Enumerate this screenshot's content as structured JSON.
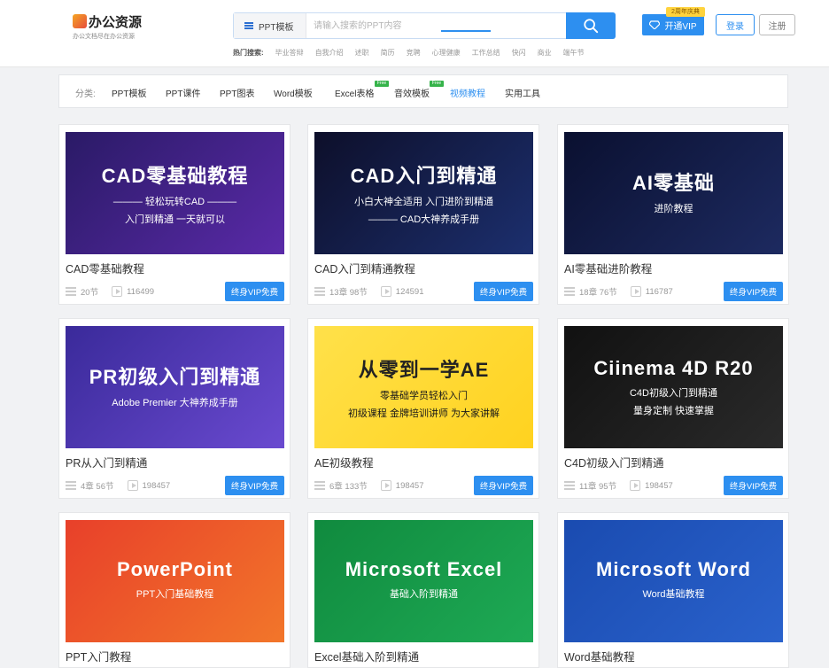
{
  "header": {
    "logo_title": "办公资源",
    "logo_subtitle": "办公文档尽在办公资源",
    "search_category": "PPT模板",
    "search_placeholder": "请输入搜索的PPT内容",
    "hot_label": "热门搜索:",
    "hot_terms": [
      "毕业答辩",
      "自我介绍",
      "述职",
      "简历",
      "竞聘",
      "心理健康",
      "工作总结",
      "快闪",
      "商业",
      "端午节"
    ],
    "vip_label": "开通VIP",
    "vip_badge": "2周年庆典",
    "login_label": "登录",
    "register_label": "注册"
  },
  "categories": {
    "label": "分类:",
    "items": [
      "PPT模板",
      "PPT课件",
      "PPT图表",
      "Word模板",
      "Excel表格",
      "音效模板",
      "视频教程",
      "实用工具"
    ],
    "free_tag": "Free",
    "active": "视频教程"
  },
  "card_button_label": "终身VIP免费",
  "cards": [
    {
      "title": "CAD零基础教程",
      "lessons": "20节",
      "views": "116499",
      "thumb_lines": [
        "CAD零基础教程",
        "——— 轻松玩转CAD ———",
        "入门到精通 一天就可以"
      ],
      "colors": [
        "#2a1a66",
        "#5a2aa8"
      ]
    },
    {
      "title": "CAD入门到精通教程",
      "lessons": "13章 98节",
      "views": "124591",
      "thumb_lines": [
        "CAD入门到精通",
        "小白大神全适用 入门进阶到精通",
        "——— CAD大神养成手册"
      ],
      "colors": [
        "#0d0f2a",
        "#1c2f6e"
      ]
    },
    {
      "title": "AI零基础进阶教程",
      "lessons": "18章 76节",
      "views": "116787",
      "thumb_lines": [
        "AI零基础",
        "进阶教程",
        ""
      ],
      "colors": [
        "#0a1030",
        "#1d2a60"
      ]
    },
    {
      "title": "PR从入门到精通",
      "lessons": "4章 56节",
      "views": "198457",
      "thumb_lines": [
        "PR初级入门到精通",
        "Adobe Premier 大神养成手册",
        ""
      ],
      "colors": [
        "#3a2a9a",
        "#6a4ad0"
      ]
    },
    {
      "title": "AE初级教程",
      "lessons": "6章 133节",
      "views": "198457",
      "thumb_lines": [
        "从零到一学AE",
        "零基础学员轻松入门",
        "初级课程  金牌培训讲师 为大家讲解"
      ],
      "colors": [
        "#ffe14a",
        "#ffd21f"
      ]
    },
    {
      "title": "C4D初级入门到精通",
      "lessons": "11章 95节",
      "views": "198457",
      "thumb_lines": [
        "Ciinema 4D R20",
        "C4D初级入门到精通",
        "量身定制  快速掌握"
      ],
      "colors": [
        "#111111",
        "#2a2a2a"
      ]
    },
    {
      "title": "PPT入门教程",
      "lessons": "",
      "views": "",
      "thumb_lines": [
        "PowerPoint",
        "PPT入门基础教程",
        ""
      ],
      "colors": [
        "#e8402a",
        "#f2762a"
      ]
    },
    {
      "title": "Excel基础入阶到精通",
      "lessons": "",
      "views": "",
      "thumb_lines": [
        "Microsoft Excel",
        "基础入阶到精通",
        ""
      ],
      "colors": [
        "#108a3e",
        "#1eaa55"
      ]
    },
    {
      "title": "Word基础教程",
      "lessons": "",
      "views": "",
      "thumb_lines": [
        "Microsoft Word",
        "Word基础教程",
        ""
      ],
      "colors": [
        "#1a4bb0",
        "#2a62cc"
      ]
    }
  ]
}
